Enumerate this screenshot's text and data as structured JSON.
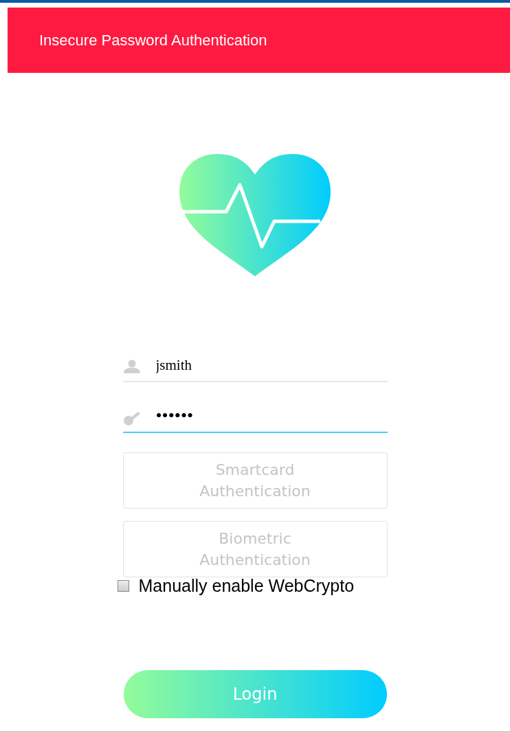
{
  "header": {
    "title": "Insecure Password Authentication"
  },
  "fields": [
    {
      "kind": "user",
      "value": "jsmith",
      "focused": false
    },
    {
      "kind": "password",
      "value": "••••••",
      "focused": true
    }
  ],
  "buttons": [
    {
      "label": "Smartcard Authentication",
      "disabled": true
    },
    {
      "label": "Biometric Authentication",
      "disabled": true
    }
  ],
  "webcrypto": {
    "label": "Manually enable WebCrypto",
    "checked": false
  },
  "login": {
    "label": "Login"
  }
}
